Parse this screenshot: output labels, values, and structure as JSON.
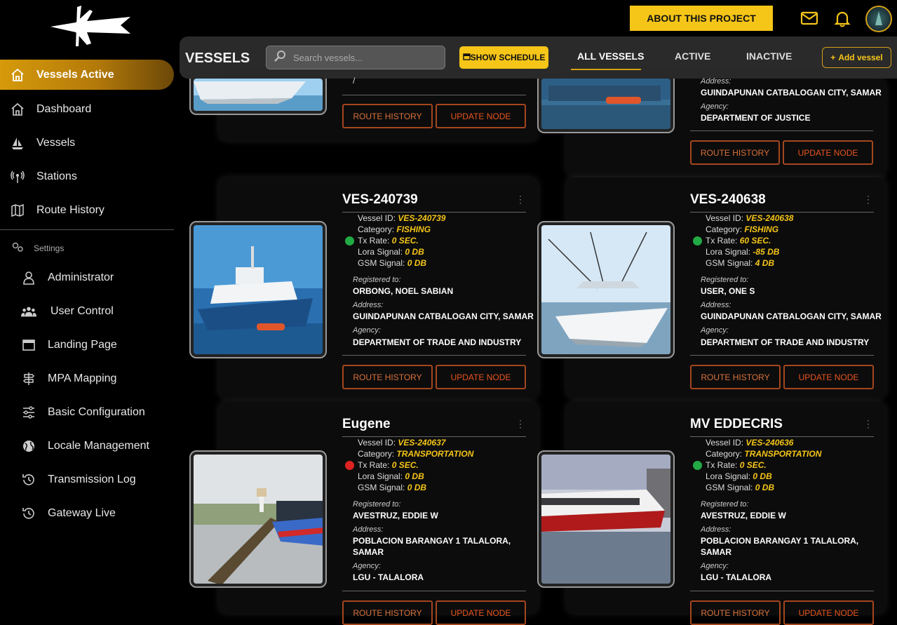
{
  "sidebar": {
    "active_item": "Vessels Active",
    "items": [
      {
        "label": "Dashboard",
        "icon": "home-icon"
      },
      {
        "label": "Vessels",
        "icon": "sailboat-icon"
      },
      {
        "label": "Stations",
        "icon": "antenna-icon"
      },
      {
        "label": "Route History",
        "icon": "map-icon"
      }
    ],
    "settings_label": "Settings",
    "settings_items": [
      {
        "label": "Administrator",
        "icon": "user-icon"
      },
      {
        "label": "User Control",
        "icon": "users-icon"
      },
      {
        "label": "Landing Page",
        "icon": "window-icon"
      },
      {
        "label": "MPA Mapping",
        "icon": "signpost-icon"
      },
      {
        "label": "Basic Configuration",
        "icon": "sliders-icon"
      },
      {
        "label": "Locale Management",
        "icon": "globe-icon"
      },
      {
        "label": "Transmission Log",
        "icon": "history-icon"
      },
      {
        "label": "Gateway Live",
        "icon": "history-icon"
      }
    ]
  },
  "header": {
    "about_label": "ABOUT THIS PROJECT"
  },
  "vessels_bar": {
    "title": "VESSELS",
    "search_placeholder": "Search vessels...",
    "schedule_label": "SHOW SCHEDULE",
    "tabs": [
      "ALL VESSELS",
      "ACTIVE",
      "INACTIVE"
    ],
    "active_tab": "ALL VESSELS",
    "add_label": "Add vessel"
  },
  "labels": {
    "vessel_id": "Vessel ID:",
    "category": "Category:",
    "tx_rate": "Tx Rate:",
    "lora": "Lora Signal:",
    "gsm": "GSM Signal:",
    "registered": "Registered to:",
    "address": "Address:",
    "agency": "Agency:",
    "route_history": "ROUTE HISTORY",
    "update_node": "UPDATE NODE"
  },
  "partial_cards": {
    "left_partial_text": "/",
    "right_address_label": "Address:",
    "right_address": "GUINDAPUNAN CATBALOGAN CITY, SAMAR",
    "right_agency_label": "Agency:",
    "right_agency": "DEPARTMENT OF JUSTICE"
  },
  "cards": [
    {
      "name": "VES-240739",
      "vessel_id": "VES-240739",
      "category": "FISHING",
      "tx_rate": "0 SEC.",
      "lora": "0 DB",
      "gsm": "0 DB",
      "status_color": "#22aa44",
      "registered": "ORBONG, NOEL SABIAN",
      "address": "GUINDAPUNAN CATBALOGAN CITY, SAMAR",
      "address2": "",
      "agency": "DEPARTMENT OF TRADE AND INDUSTRY"
    },
    {
      "name": "VES-240638",
      "vessel_id": "VES-240638",
      "category": "FISHING",
      "tx_rate": "60 SEC.",
      "lora": "-85 DB",
      "gsm": "4 DB",
      "status_color": "#22aa44",
      "registered": "USER, ONE S",
      "address": "GUINDAPUNAN CATBALOGAN CITY, SAMAR",
      "address2": "",
      "agency": "DEPARTMENT OF TRADE AND INDUSTRY"
    },
    {
      "name": "Eugene",
      "vessel_id": "VES-240637",
      "category": "TRANSPORTATION",
      "tx_rate": "0 SEC.",
      "lora": "0 DB",
      "gsm": "0 DB",
      "status_color": "#dd2222",
      "registered": "AVESTRUZ, EDDIE W",
      "address": "POBLACION BARANGAY 1 TALALORA,",
      "address2": "SAMAR",
      "agency": "LGU - TALALORA"
    },
    {
      "name": "MV EDDECRIS",
      "vessel_id": "VES-240636",
      "category": "TRANSPORTATION",
      "tx_rate": "0 SEC.",
      "lora": "0 DB",
      "gsm": "0 DB",
      "status_color": "#22aa44",
      "registered": "AVESTRUZ, EDDIE W",
      "address": "POBLACION BARANGAY 1 TALALORA,",
      "address2": "SAMAR",
      "agency": "LGU - TALALORA"
    }
  ],
  "colors": {
    "accent": "#f5c518",
    "brand_gold": "#d69a0a",
    "button_border": "#a5461e",
    "online": "#22aa44",
    "offline": "#dd2222"
  }
}
